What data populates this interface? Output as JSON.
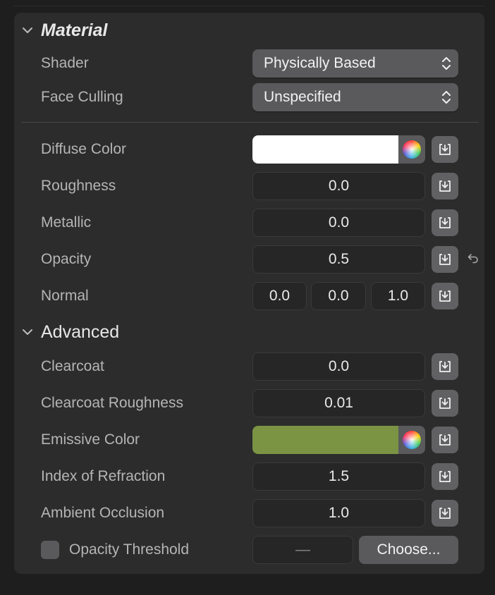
{
  "material": {
    "title": "Material",
    "shader": {
      "label": "Shader",
      "value": "Physically Based"
    },
    "face_culling": {
      "label": "Face Culling",
      "value": "Unspecified"
    },
    "diffuse_color": {
      "label": "Diffuse Color",
      "color": "#ffffff"
    },
    "roughness": {
      "label": "Roughness",
      "value": "0.0"
    },
    "metallic": {
      "label": "Metallic",
      "value": "0.0"
    },
    "opacity": {
      "label": "Opacity",
      "value": "0.5"
    },
    "normal": {
      "label": "Normal",
      "x": "0.0",
      "y": "0.0",
      "z": "1.0"
    }
  },
  "advanced": {
    "title": "Advanced",
    "clearcoat": {
      "label": "Clearcoat",
      "value": "0.0"
    },
    "clearcoat_roughness": {
      "label": "Clearcoat Roughness",
      "value": "0.01"
    },
    "emissive_color": {
      "label": "Emissive Color",
      "color": "#7a9444"
    },
    "index_of_refraction": {
      "label": "Index of Refraction",
      "value": "1.5"
    },
    "ambient_occlusion": {
      "label": "Ambient Occlusion",
      "value": "1.0"
    },
    "opacity_threshold": {
      "label": "Opacity Threshold",
      "value": "—",
      "choose_label": "Choose..."
    }
  },
  "icons": {
    "collapse": "chevron-down-icon",
    "popup": "up-down-chevron-icon",
    "connect": "import-tray-icon",
    "revert": "revert-arrow-icon",
    "color_picker": "color-wheel-icon"
  }
}
